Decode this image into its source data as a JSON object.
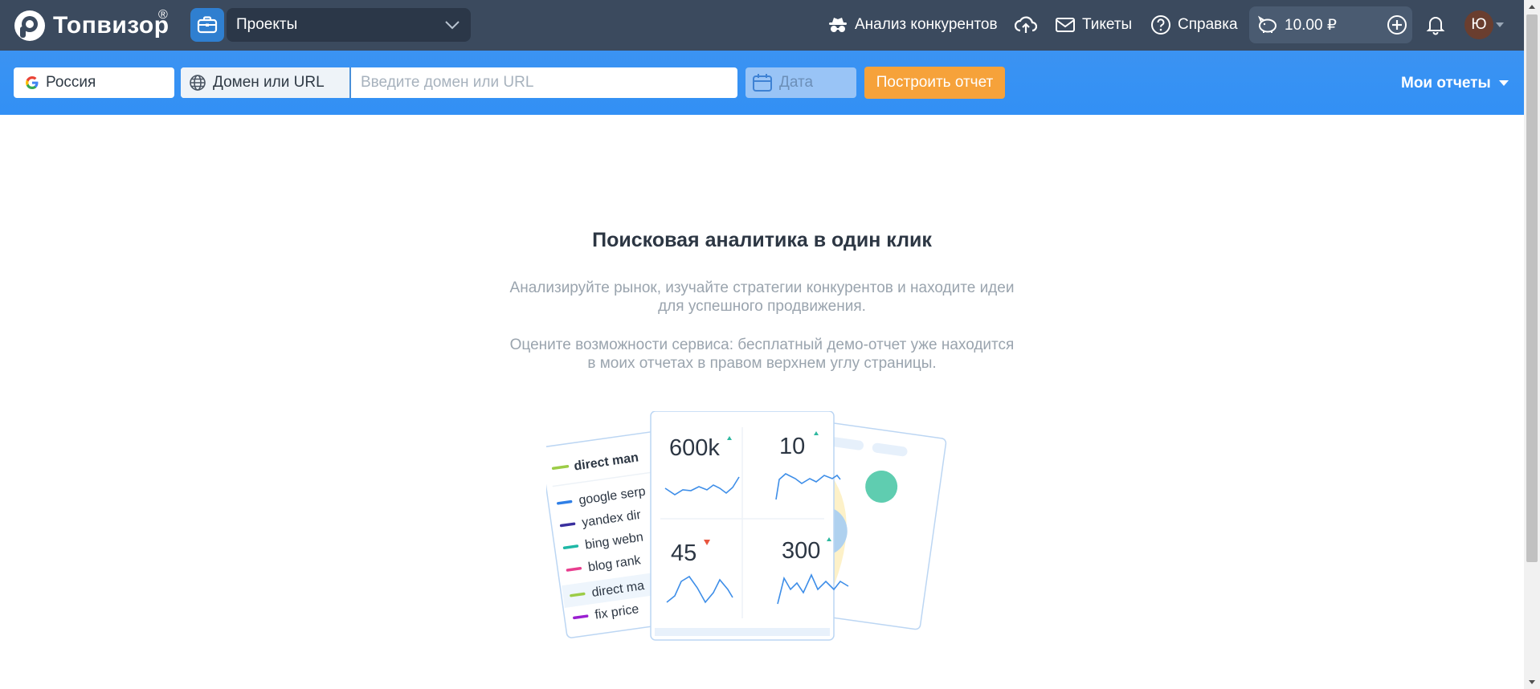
{
  "app": {
    "logo_text": "Топвизор",
    "logo_reg": "®"
  },
  "topbar": {
    "projects_label": "Проекты",
    "competitors_label": "Анализ конкурентов",
    "tickets_label": "Тикеты",
    "help_label": "Справка",
    "balance": "10.00 ₽",
    "avatar_initial": "Ю"
  },
  "toolbar": {
    "region": "Россия",
    "url_type": "Домен или URL",
    "url_placeholder": "Введите домен или URL",
    "date_placeholder": "Дата",
    "build_label": "Построить отчет",
    "my_reports_label": "Мои отчеты"
  },
  "main": {
    "title": "Поисковая аналитика в один клик",
    "paragraph1": "Анализируйте рынок, изучайте стратегии конкурентов и находите идеи для успешного продвижения.",
    "paragraph2": "Оцените возможности сервиса: бесплатный демо-отчет уже находится в моих отчетах в правом верхнем углу страницы."
  },
  "illustration": {
    "list_header": "direct man",
    "list_items": [
      "google serp",
      "yandex dir",
      "bing webn",
      "blog rank",
      "direct ma",
      "fix price"
    ],
    "metrics": [
      {
        "value": "600k",
        "trend": "up"
      },
      {
        "value": "10",
        "trend": "up"
      },
      {
        "value": "45",
        "trend": "down"
      },
      {
        "value": "300",
        "trend": "up"
      }
    ]
  },
  "colors": {
    "topbar": "#3b4a5e",
    "toolbar": "#3290f5",
    "accent_orange": "#f6a23a",
    "trend_up": "#2fb8a0",
    "trend_down": "#e8553e"
  }
}
